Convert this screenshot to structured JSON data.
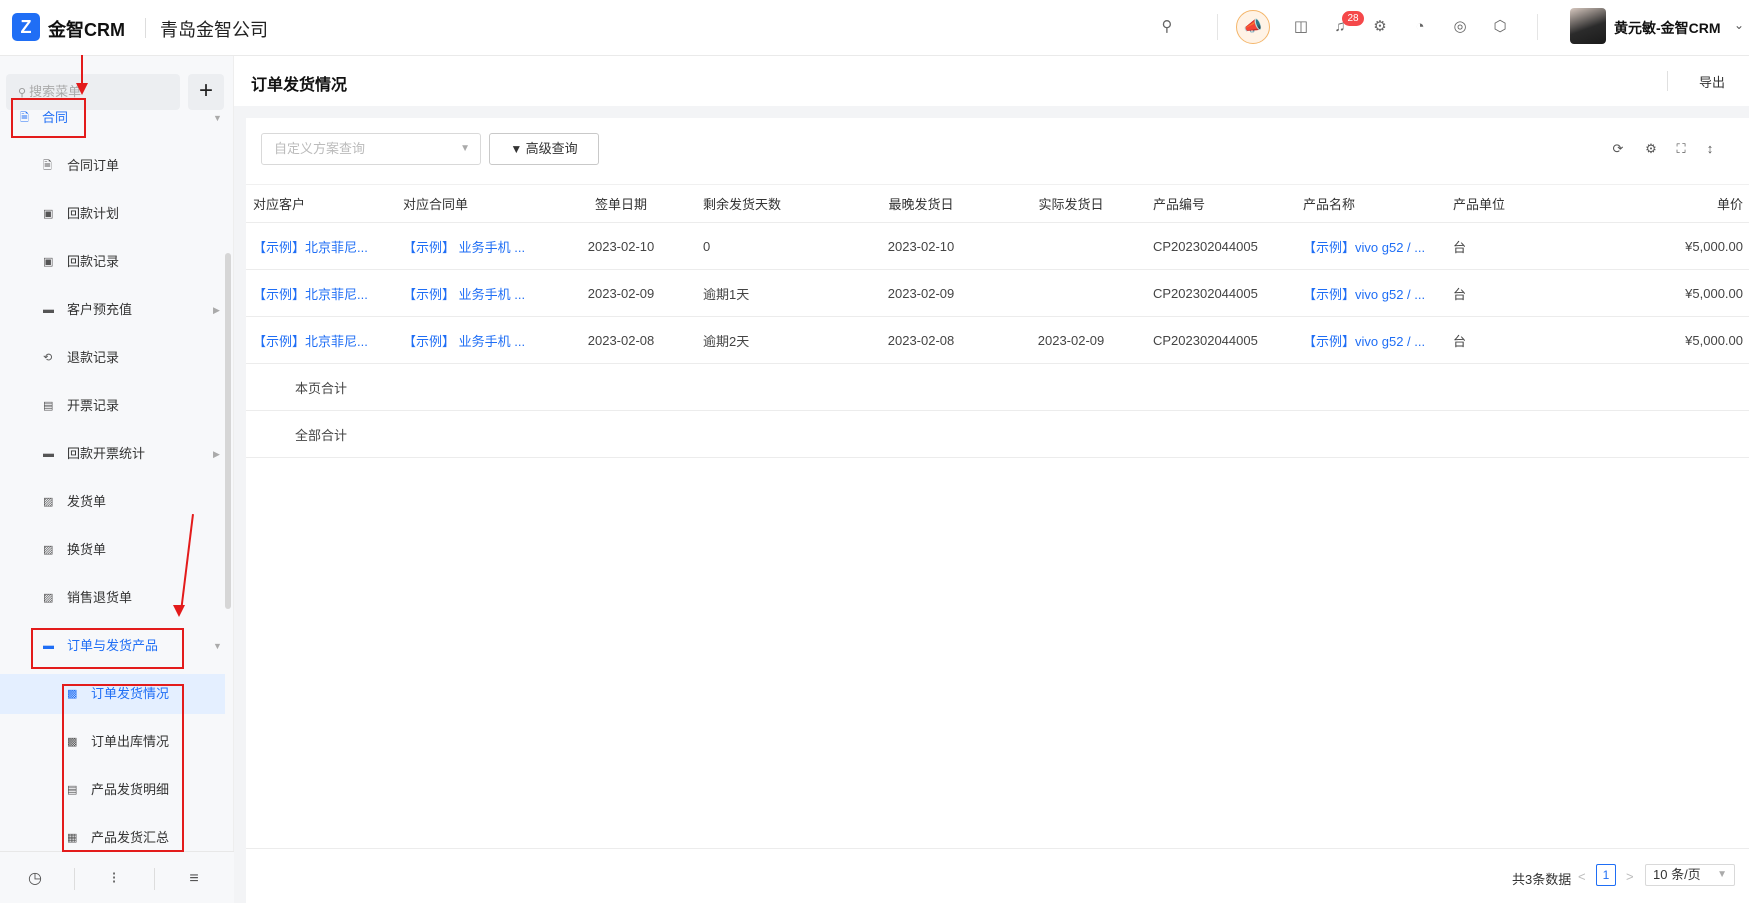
{
  "topbar": {
    "logo_glyph": "Z",
    "brand": "金智CRM",
    "company": "青岛金智公司",
    "notification_count": "28",
    "user_name": "黄元敏-金智CRM",
    "icons": [
      "search-icon",
      "promo-speaker-icon",
      "inbox-icon",
      "bell-icon",
      "gear-icon",
      "pie-chart-icon",
      "chrome-icon",
      "cube-icon"
    ]
  },
  "sidebar": {
    "search_placeholder": "搜索菜单",
    "add_label": "+",
    "items": [
      {
        "label": "合同",
        "icon": "document-icon"
      },
      {
        "label": "合同订单",
        "icon": "document-icon"
      },
      {
        "label": "回款计划",
        "icon": "money-box-icon"
      },
      {
        "label": "回款记录",
        "icon": "money-box-icon"
      },
      {
        "label": "客户预充值",
        "icon": "folder-icon"
      },
      {
        "label": "退款记录",
        "icon": "refund-icon"
      },
      {
        "label": "开票记录",
        "icon": "printer-icon"
      },
      {
        "label": "回款开票统计",
        "icon": "folder-icon"
      },
      {
        "label": "发货单",
        "icon": "box-icon"
      },
      {
        "label": "换货单",
        "icon": "box-icon"
      },
      {
        "label": "销售退货单",
        "icon": "box-icon"
      },
      {
        "label": "订单与发货产品",
        "icon": "folder-icon"
      },
      {
        "label": "订单发货情况",
        "icon": "clipboard-icon"
      },
      {
        "label": "订单出库情况",
        "icon": "clipboard-icon"
      },
      {
        "label": "产品发货明细",
        "icon": "list-icon"
      },
      {
        "label": "产品发货汇总",
        "icon": "calculator-icon"
      }
    ],
    "footer_icons": [
      "history-icon",
      "sliders-icon",
      "collapse-menu-icon"
    ]
  },
  "page": {
    "title": "订单发货情况",
    "export_label": "导出",
    "scheme_placeholder": "自定义方案查询",
    "advanced_query": "高级查询",
    "toolbar_icons": [
      "refresh-icon",
      "settings-icon",
      "fullscreen-icon",
      "row-height-icon"
    ]
  },
  "table": {
    "columns": [
      "对应客户",
      "对应合同单",
      "签单日期",
      "剩余发货天数",
      "最晚发货日",
      "实际发货日",
      "产品编号",
      "产品名称",
      "产品单位",
      "单价"
    ],
    "rows": [
      [
        "【示例】北京菲尼...",
        "【示例】 业务手机 ...",
        "2023-02-10",
        "0",
        "2023-02-10",
        "",
        "CP202302044005",
        "【示例】vivo g52 / ...",
        "台",
        "¥5,000.00"
      ],
      [
        "【示例】北京菲尼...",
        "【示例】 业务手机 ...",
        "2023-02-09",
        "逾期1天",
        "2023-02-09",
        "",
        "CP202302044005",
        "【示例】vivo g52 / ...",
        "台",
        "¥5,000.00"
      ],
      [
        "【示例】北京菲尼...",
        "【示例】 业务手机 ...",
        "2023-02-08",
        "逾期2天",
        "2023-02-08",
        "2023-02-09",
        "CP202302044005",
        "【示例】vivo g52 / ...",
        "台",
        "¥5,000.00"
      ]
    ],
    "page_total_label": "本页合计",
    "all_total_label": "全部合计"
  },
  "pager": {
    "total_text": "共3条数据",
    "current_page": "1",
    "page_size": "10 条/页"
  }
}
